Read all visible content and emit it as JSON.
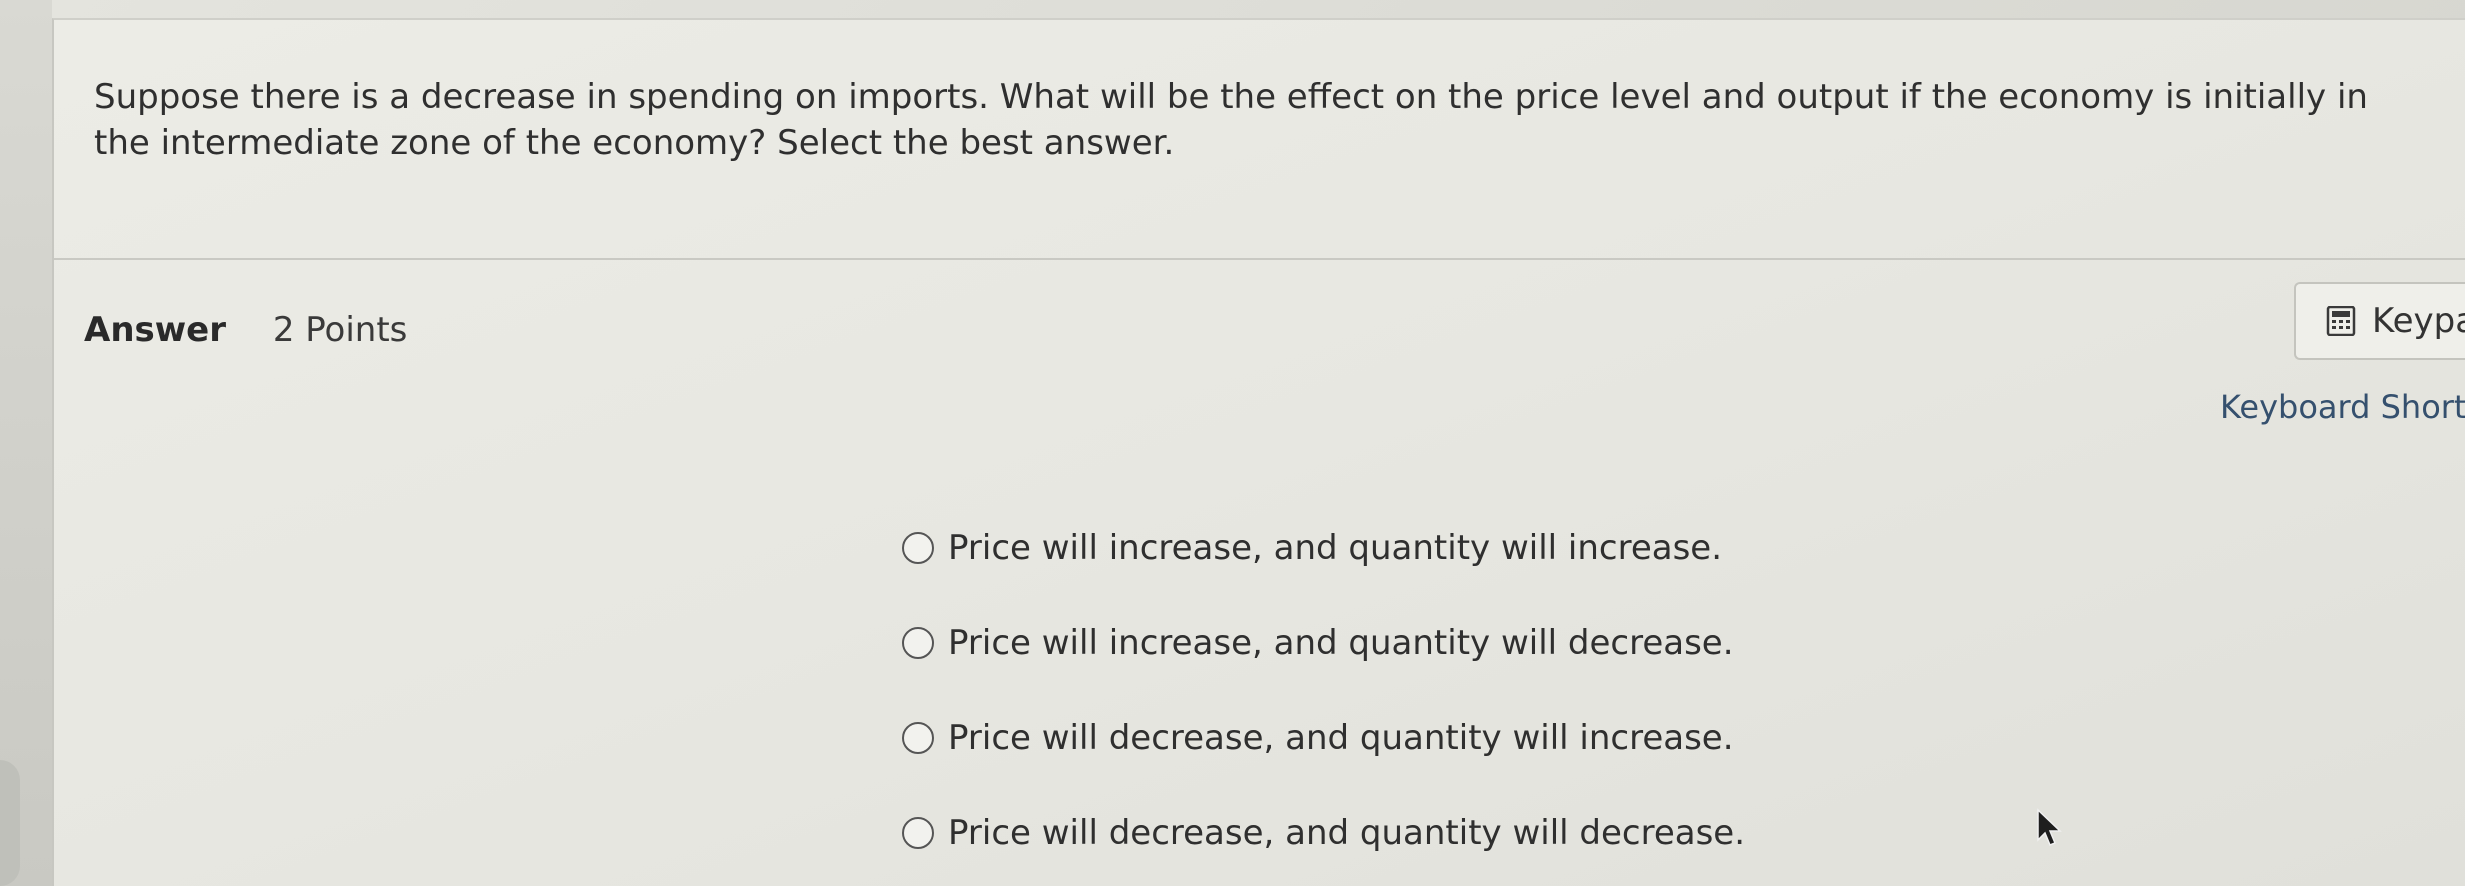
{
  "question": {
    "text": "Suppose there is a decrease in spending on imports. What will be the effect on the price level and output if the economy is initially in the intermediate zone of the economy? Select the best answer."
  },
  "answer": {
    "label": "Answer",
    "points": "2 Points"
  },
  "keypad": {
    "label": "Keypa",
    "icon": "calculator-icon"
  },
  "keyboard_shortcuts": {
    "label": "Keyboard Short"
  },
  "options": [
    {
      "label": "Price will increase, and quantity will increase."
    },
    {
      "label": "Price will increase, and quantity will decrease."
    },
    {
      "label": "Price will decrease, and quantity will increase."
    },
    {
      "label": "Price will decrease, and quantity will decrease."
    }
  ]
}
